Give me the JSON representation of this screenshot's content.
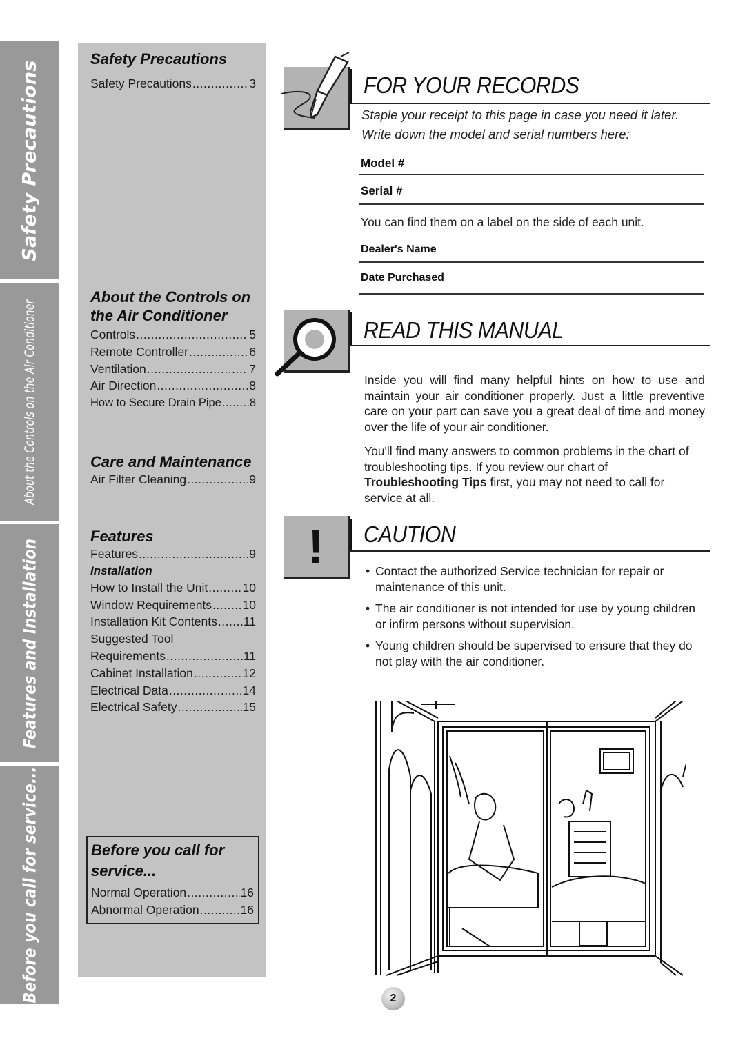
{
  "side_tabs": [
    {
      "label": "Safety Precautions"
    },
    {
      "label": "About the Controls on the Air Conditioner"
    },
    {
      "label": "Features and Installation"
    },
    {
      "label": "Before you call for service..."
    }
  ],
  "toc": {
    "safety": {
      "heading": "Safety Precautions",
      "items": [
        {
          "label": "Safety Precautions",
          "page": "3"
        }
      ]
    },
    "controls": {
      "heading_line1": "About the Controls on",
      "heading_line2": "the Air Conditioner",
      "items": [
        {
          "label": "Controls",
          "page": "5"
        },
        {
          "label": "Remote Controller",
          "page": "6"
        },
        {
          "label": "Ventilation",
          "page": "7"
        },
        {
          "label": "Air Direction",
          "page": "8"
        },
        {
          "label": "How to Secure Drain Pipe",
          "page": "8"
        }
      ]
    },
    "care": {
      "heading": "Care and Maintenance",
      "items": [
        {
          "label": "Air Filter Cleaning",
          "page": "9"
        }
      ]
    },
    "features": {
      "heading": "Features",
      "items": [
        {
          "label": "Features",
          "page": "9"
        }
      ],
      "subheading": "Installation",
      "install_items": [
        {
          "label": "How to Install the Unit",
          "page": "10"
        },
        {
          "label": "Window Requirements",
          "page": "10"
        },
        {
          "label": "Installation Kit Contents",
          "page": "11"
        },
        {
          "label": "Suggested Tool",
          "page": ""
        },
        {
          "label": "Requirements",
          "page": "11"
        },
        {
          "label": "Cabinet Installation",
          "page": "12"
        },
        {
          "label": "Electrical Data",
          "page": "14"
        },
        {
          "label": "Electrical Safety",
          "page": "15"
        }
      ]
    },
    "service": {
      "heading_line1": "Before you call for",
      "heading_line2": "service...",
      "items": [
        {
          "label": "Normal Operation",
          "page": "16"
        },
        {
          "label": "Abnormal Operation",
          "page": "16"
        }
      ]
    }
  },
  "records": {
    "icon": "pen-icon",
    "title": "FOR YOUR RECORDS",
    "intro_line1": "Staple your receipt to this page in case you need it later.",
    "intro_line2": "Write down the model and serial numbers here:",
    "model_label": "Model #",
    "serial_label": "Serial #",
    "find_note": "You can find them on a label on the side of each unit.",
    "dealer_label": "Dealer's Name",
    "date_label": "Date Purchased"
  },
  "manual": {
    "icon": "magnifier-icon",
    "title": "READ THIS MANUAL",
    "para1": "Inside you will find many helpful hints on how to use and maintain your air conditioner properly. Just a little preventive care on your part can save you a great deal of time and money over the life of your air conditioner.",
    "para2_before": "You'll find many answers to common problems in the chart of troubleshooting tips. If you review our chart of ",
    "para2_bold": "Troubleshooting Tips",
    "para2_after": " first, you may not need to call for service at all."
  },
  "caution": {
    "icon": "exclamation-icon",
    "glyph": "!",
    "title": "CAUTION",
    "bullet_char": "•",
    "bullets": [
      "Contact the authorized Service technician for repair or maintenance of this unit.",
      "The air conditioner is not intended for use by young children or infirm persons without supervision.",
      "Young children should be supervised to ensure that they do not play with the air conditioner."
    ]
  },
  "illustration": {
    "subject": "family-living-room-through-window"
  },
  "page_number": "2",
  "colors": {
    "tab_gray": "#999999",
    "toc_gray": "#c3c3c3",
    "icon_gray": "#b3b3b3"
  }
}
